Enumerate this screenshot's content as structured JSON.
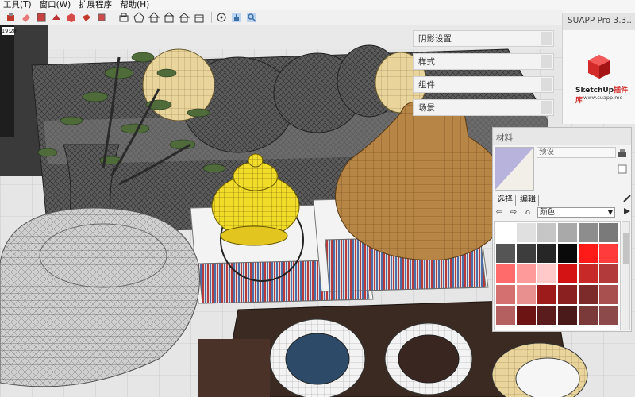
{
  "menu": {
    "items": [
      "工具(T)",
      "窗口(W)",
      "扩展程序",
      "帮助(H)"
    ]
  },
  "toolbar": {
    "icons": [
      "paint-bucket-icon",
      "eraser-icon",
      "section-plane-icon",
      "paint-icon",
      "rotate-icon",
      "follow-me-icon",
      "offset-icon",
      "components-icon",
      "iso-view-icon",
      "top-view-icon",
      "front-view-icon",
      "right-view-icon",
      "back-view-icon",
      "left-view-icon",
      "orbit-icon",
      "pan-icon",
      "zoom-icon"
    ]
  },
  "tray": {
    "shadows_label": "阴影设置",
    "styles_label": "样式",
    "components_label": "组件",
    "scenes_label": "场景"
  },
  "suapp": {
    "title": "SUAPP Pro 3.3...",
    "logo_text_a": "SketchUp",
    "logo_text_b": "插件库",
    "logo_url": "www.suapp.me"
  },
  "materials": {
    "title": "材料",
    "name_placeholder": "预设",
    "tab_select": "选择",
    "tab_edit": "编辑",
    "collection": "颜色",
    "colors": [
      "#ffffff",
      "#e0e0e0",
      "#c6c6c6",
      "#a9a9a9",
      "#8d8d8d",
      "#7a7a7a",
      "#555555",
      "#3d3d3d",
      "#262626",
      "#0a0a0a",
      "#ff1a1a",
      "#ff3b3b",
      "#ff6b6b",
      "#ff9a9a",
      "#ffc9c9",
      "#d41414",
      "#c72828",
      "#b23a3a",
      "#d47070",
      "#e89090",
      "#9e1b1b",
      "#8a2020",
      "#7c2a2a",
      "#a85050",
      "#b46060",
      "#6c1414",
      "#5a1c1c",
      "#4a1a1a",
      "#7a3a3a",
      "#8d4a4a"
    ]
  },
  "clock": "19:28"
}
